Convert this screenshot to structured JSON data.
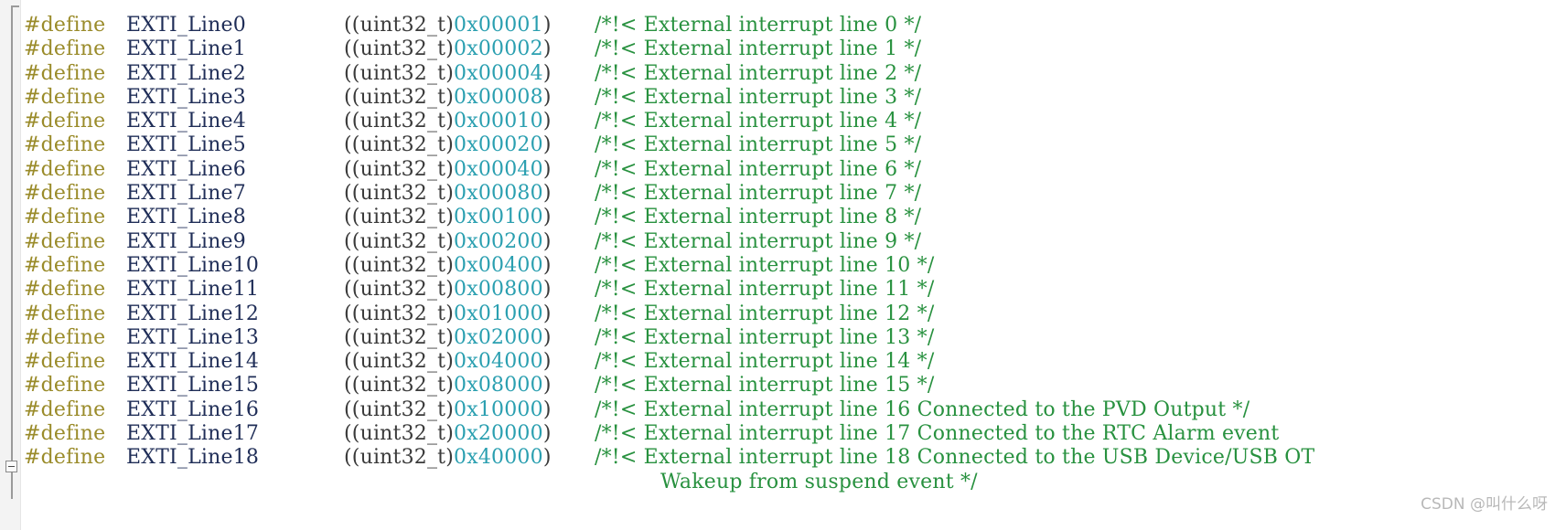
{
  "editor": {
    "language": "c",
    "background_color": "#ffffff",
    "gutter_color": "#f3f3f3",
    "fold_collapse_label": "-"
  },
  "syntax_colors": {
    "preprocessor": "#9a8b2a",
    "identifier": "#1f2d57",
    "type": "#3a3a3a",
    "punctuation": "#3a3a3a",
    "number": "#2a9fb0",
    "comment": "#28913f"
  },
  "code": {
    "directive": "#define",
    "cast_open": "((",
    "cast_type": "uint32_t",
    "cast_close": ")",
    "lines": [
      {
        "name": "EXTI_Line0",
        "value": "0x00001",
        "comment": "/*!< External interrupt line 0 */"
      },
      {
        "name": "EXTI_Line1",
        "value": "0x00002",
        "comment": "/*!< External interrupt line 1 */"
      },
      {
        "name": "EXTI_Line2",
        "value": "0x00004",
        "comment": "/*!< External interrupt line 2 */"
      },
      {
        "name": "EXTI_Line3",
        "value": "0x00008",
        "comment": "/*!< External interrupt line 3 */"
      },
      {
        "name": "EXTI_Line4",
        "value": "0x00010",
        "comment": "/*!< External interrupt line 4 */"
      },
      {
        "name": "EXTI_Line5",
        "value": "0x00020",
        "comment": "/*!< External interrupt line 5 */"
      },
      {
        "name": "EXTI_Line6",
        "value": "0x00040",
        "comment": "/*!< External interrupt line 6 */"
      },
      {
        "name": "EXTI_Line7",
        "value": "0x00080",
        "comment": "/*!< External interrupt line 7 */"
      },
      {
        "name": "EXTI_Line8",
        "value": "0x00100",
        "comment": "/*!< External interrupt line 8 */"
      },
      {
        "name": "EXTI_Line9",
        "value": "0x00200",
        "comment": "/*!< External interrupt line 9 */"
      },
      {
        "name": "EXTI_Line10",
        "value": "0x00400",
        "comment": "/*!< External interrupt line 10 */"
      },
      {
        "name": "EXTI_Line11",
        "value": "0x00800",
        "comment": "/*!< External interrupt line 11 */"
      },
      {
        "name": "EXTI_Line12",
        "value": "0x01000",
        "comment": "/*!< External interrupt line 12 */"
      },
      {
        "name": "EXTI_Line13",
        "value": "0x02000",
        "comment": "/*!< External interrupt line 13 */"
      },
      {
        "name": "EXTI_Line14",
        "value": "0x04000",
        "comment": "/*!< External interrupt line 14 */"
      },
      {
        "name": "EXTI_Line15",
        "value": "0x08000",
        "comment": "/*!< External interrupt line 15 */"
      },
      {
        "name": "EXTI_Line16",
        "value": "0x10000",
        "comment": "/*!< External interrupt line 16 Connected to the PVD Output */"
      },
      {
        "name": "EXTI_Line17",
        "value": "0x20000",
        "comment": "/*!< External interrupt line 17 Connected to the RTC Alarm event "
      },
      {
        "name": "EXTI_Line18",
        "value": "0x40000",
        "comment": "/*!< External interrupt line 18 Connected to the USB Device/USB OT"
      }
    ],
    "continuation_comment": "Wakeup from suspend event */"
  },
  "watermark": {
    "text": "CSDN @叫什么呀"
  }
}
